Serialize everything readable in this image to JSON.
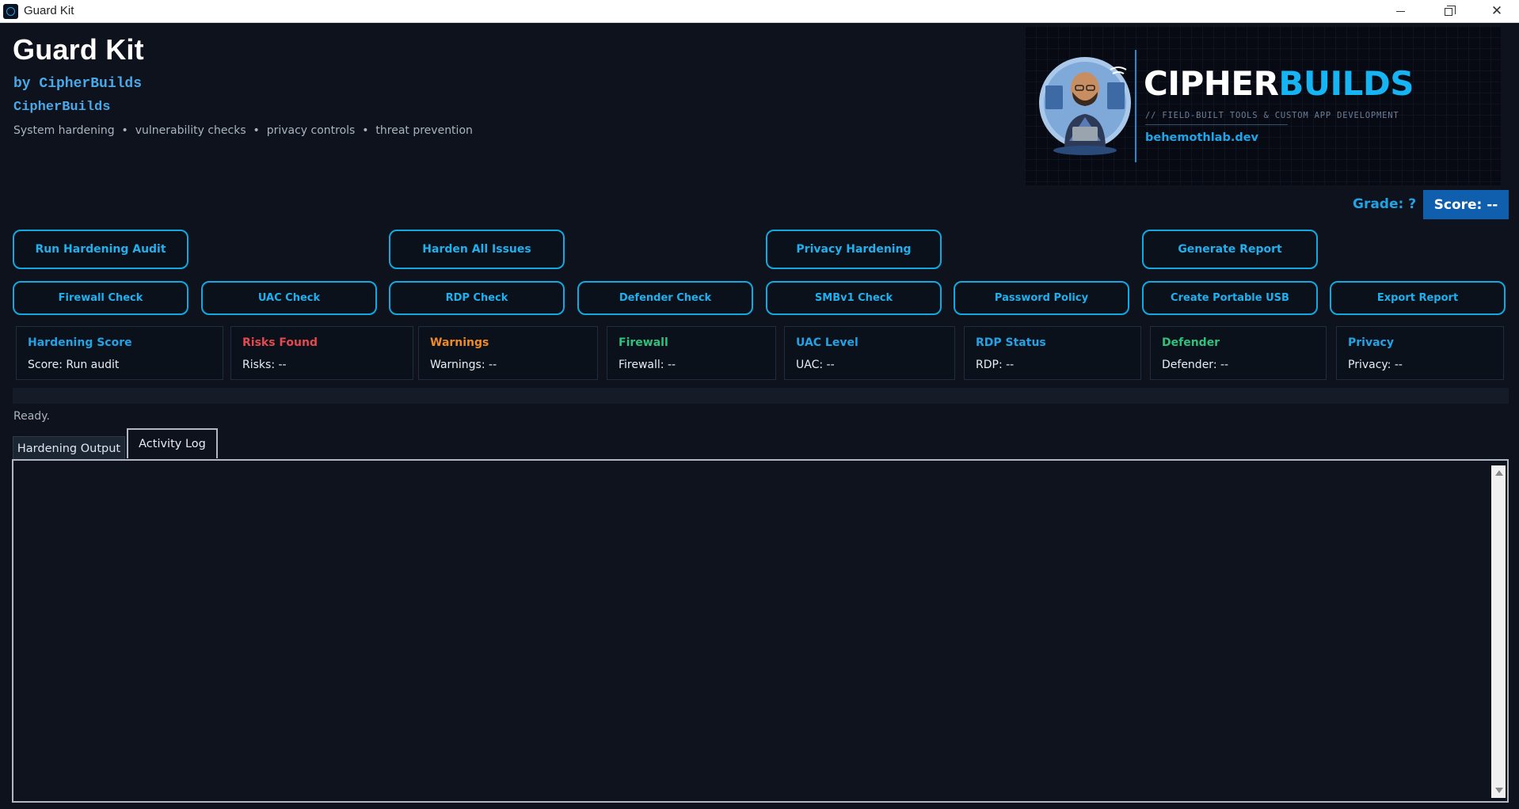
{
  "window": {
    "title": "Guard Kit"
  },
  "header": {
    "title": "Guard Kit",
    "by_line": "by CipherBuilds",
    "brand": "CipherBuilds",
    "tagline": "System hardening  •  vulnerability checks  •  privacy controls  •  threat prevention"
  },
  "banner": {
    "brand_white": "CIPHER",
    "brand_blue": "BUILDS",
    "subtitle": "// FIELD-BUILT TOOLS & CUSTOM APP DEVELOPMENT",
    "url": "behemothlab.dev"
  },
  "score": {
    "grade": "Grade: ?",
    "score": "Score: --"
  },
  "primary_actions": [
    "Run Hardening Audit",
    "Harden All Issues",
    "Privacy Hardening",
    "Generate Report"
  ],
  "checks": [
    "Firewall Check",
    "UAC Check",
    "RDP Check",
    "Defender Check",
    "SMBv1 Check",
    "Password Policy",
    "Create Portable USB",
    "Export Report"
  ],
  "cards": [
    {
      "title": "Hardening Score",
      "value": "Score: Run audit",
      "color": "#21a3e6"
    },
    {
      "title": "Risks Found",
      "value": "Risks: --",
      "color": "#e5484d"
    },
    {
      "title": "Warnings",
      "value": "Warnings: --",
      "color": "#f08a24"
    },
    {
      "title": "Firewall",
      "value": "Firewall: --",
      "color": "#2ec27e"
    },
    {
      "title": "UAC Level",
      "value": "UAC: --",
      "color": "#21a3e6"
    },
    {
      "title": "RDP Status",
      "value": "RDP: --",
      "color": "#21a3e6"
    },
    {
      "title": "Defender",
      "value": "Defender: --",
      "color": "#2ec27e"
    },
    {
      "title": "Privacy",
      "value": "Privacy: --",
      "color": "#21a3e6"
    }
  ],
  "progress": {
    "fraction": 0
  },
  "status": "Ready.",
  "tabs": [
    "Hardening Output",
    "Activity Log"
  ],
  "colors": {
    "accent": "#12a8e0",
    "background": "#0d121c",
    "score_badge": "#0f5fae"
  }
}
